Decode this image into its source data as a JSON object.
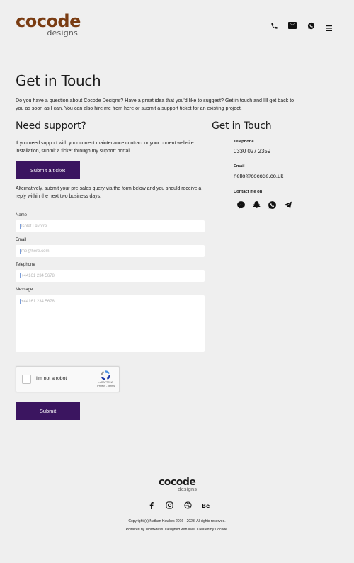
{
  "brand": {
    "name": "cocode",
    "sub": "designs",
    "color": "#7a3c12"
  },
  "header": {
    "icons": [
      "phone-icon",
      "mail-icon",
      "whatsapp-icon"
    ],
    "menu_icon": "hamburger-menu-icon"
  },
  "page": {
    "title": "Get in Touch",
    "intro": "Do you have a question about Cocode Designs? Have a great idea that you'd like to suggest? Get in touch and I'll get back to you as soon as I can. You can also hire me from here or submit a support ticket for an existing project."
  },
  "support": {
    "heading": "Need support?",
    "text": "If you need support with your current maintenance contract or your current website installation, submit a ticket through my support portal.",
    "button": "Submit a ticket",
    "alt_text": "Alternatively, submit your pre-sales query via the form below and you should receive a reply within the next two business days."
  },
  "form": {
    "name_label": "Name",
    "name_placeholder": "Isolet Lavorre",
    "email_label": "Email",
    "email_placeholder": "me@here.com",
    "phone_label": "Telephone",
    "phone_placeholder": "+44161 234 5678",
    "message_label": "Message",
    "message_placeholder": "+44161 234 5678",
    "captcha_text": "I'm not a robot",
    "captcha_brand": "reCAPTCHA",
    "captcha_links": "Privacy - Terms",
    "submit": "Submit"
  },
  "contact": {
    "heading": "Get in Touch",
    "phone_label": "Telephone",
    "phone": "0330 027 2359",
    "email_label": "Email",
    "email": "hello@cocode.co.uk",
    "social_label": "Contact me on",
    "social_icons": [
      "messenger-icon",
      "snapchat-icon",
      "whatsapp-icon",
      "telegram-icon"
    ]
  },
  "footer": {
    "logo_main": "cocode",
    "logo_sub": "designs",
    "social_icons": [
      "facebook-icon",
      "instagram-icon",
      "dribbble-icon",
      "behance-icon"
    ],
    "copyright": "Copyright (c) Nathan Hawkes 2016 - 2023.  All rights reserved.",
    "powered": "Powered by WordPress.  Designed with love.  Created by Cocode."
  },
  "colors": {
    "accent": "#3b1560",
    "background": "#efefef"
  }
}
